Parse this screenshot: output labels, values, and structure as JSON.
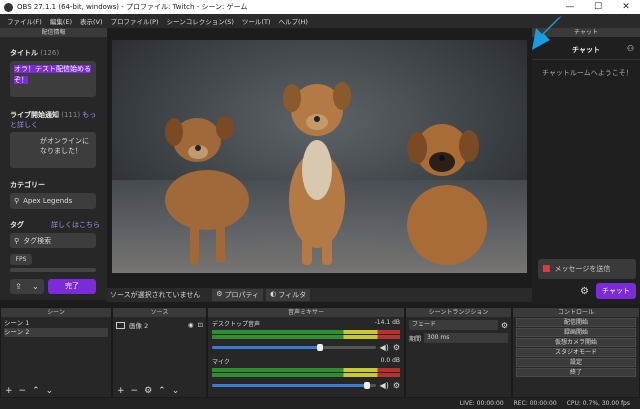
{
  "window": {
    "title": "OBS 27.1.1 (64-bit, windows) - プロファイル: Twitch - シーン: ゲーム",
    "min": "—",
    "max": "☐",
    "close": "✕"
  },
  "menu": [
    "ファイル(F)",
    "編集(E)",
    "表示(V)",
    "プロファイル(P)",
    "シーンコレクション(S)",
    "ツール(T)",
    "ヘルプ(H)"
  ],
  "stream_info": {
    "dock_title": "配信情報",
    "title_label": "タイトル",
    "title_count": "(126)",
    "title_value": "オラ！テスト配信始めるぞ！",
    "notify_label": "ライブ開始通知",
    "notify_count": "(111)",
    "notify_more": "もっと詳しく",
    "notify_value": "がオンラインになりました！",
    "category_label": "カテゴリー",
    "category_value": "Apex Legends",
    "tags_label": "タグ",
    "tags_more": "詳しくはこちら",
    "tags_placeholder": "タグ検索",
    "tag_chip": "FPS",
    "done_button": "完了"
  },
  "source_bar": {
    "no_source": "ソースが選択されていません",
    "properties": "プロパティ",
    "filters": "フィルタ"
  },
  "chat": {
    "dock_title": "チャット",
    "header": "チャット",
    "welcome": "チャットルームへようこそ！",
    "message_placeholder": "メッセージを送信",
    "send_button": "チャット",
    "accent": "#7c2bd8"
  },
  "scenes": {
    "title": "シーン",
    "items": [
      "シーン 1",
      "シーン 2"
    ],
    "selected": 1
  },
  "sources": {
    "title": "ソース",
    "items": [
      "画像 2"
    ]
  },
  "mixer": {
    "title": "音声ミキサー",
    "channels": [
      {
        "name": "デスクトップ音声",
        "db": "-14.1 dB",
        "level": 0.66
      },
      {
        "name": "マイク",
        "db": "0.0 dB",
        "level": 0.95
      }
    ]
  },
  "transitions": {
    "title": "シーントランジション",
    "type": "フェード",
    "duration_label": "期間",
    "duration_value": "300 ms"
  },
  "controls": {
    "title": "コントロール",
    "buttons": [
      "配信開始",
      "録画開始",
      "仮想カメラ開始",
      "スタジオモード",
      "設定",
      "終了"
    ]
  },
  "status": {
    "live": "LIVE: 00:00:00",
    "rec": "REC: 00:00:00",
    "cpu": "CPU: 0.7%, 30.00 fps"
  }
}
